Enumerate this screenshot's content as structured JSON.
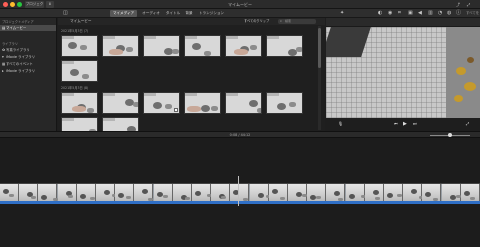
{
  "window": {
    "title": "マイムービー",
    "back_label": "プロジェクト",
    "left_buttons": [
      "◀",
      "⬇"
    ]
  },
  "toolbar": {
    "tabs": [
      {
        "label": "マイメディア",
        "active": true
      },
      {
        "label": "オーディオ",
        "active": false
      },
      {
        "label": "タイトル",
        "active": false
      },
      {
        "label": "背景",
        "active": false
      },
      {
        "label": "トランジション",
        "active": false
      }
    ],
    "right_label": "すべてをリセット"
  },
  "sidebar": {
    "section1": "プロジェクトメディア",
    "items": [
      {
        "label": "マイムービー",
        "icon": "film-icon",
        "selected": true
      }
    ],
    "section2": "ライブラリ",
    "library": [
      {
        "label": "写真ライブラリ",
        "icon": "photos-icon"
      },
      {
        "label": "iMovie ライブラリ",
        "icon": "library-icon"
      },
      {
        "label": "すべてのイベント",
        "icon": "events-icon"
      },
      {
        "label": "iMovie ライブラリ",
        "icon": "library-icon"
      }
    ]
  },
  "browser": {
    "title": "マイムービー",
    "filter_label": "すべてのクリップ",
    "search_placeholder": "検索",
    "groups": [
      {
        "date": "2021年5月3日  (7)",
        "thumb_count": 7
      },
      {
        "date": "2021年5月3日  (8)",
        "thumb_count": 8
      }
    ],
    "clip_label": "0:05"
  },
  "viewer": {
    "controls": {
      "mic": "🎙",
      "prev": "⏮",
      "play": "▶",
      "next": "⏭"
    }
  },
  "timeline": {
    "timecode": "0:08 / 44:12",
    "frame_count": 25
  },
  "colors": {
    "accent": "#2f6fc6",
    "active_tab": "#575757",
    "sidebar_bg": "#272727",
    "timeline_bg": "#1c1c1c"
  }
}
